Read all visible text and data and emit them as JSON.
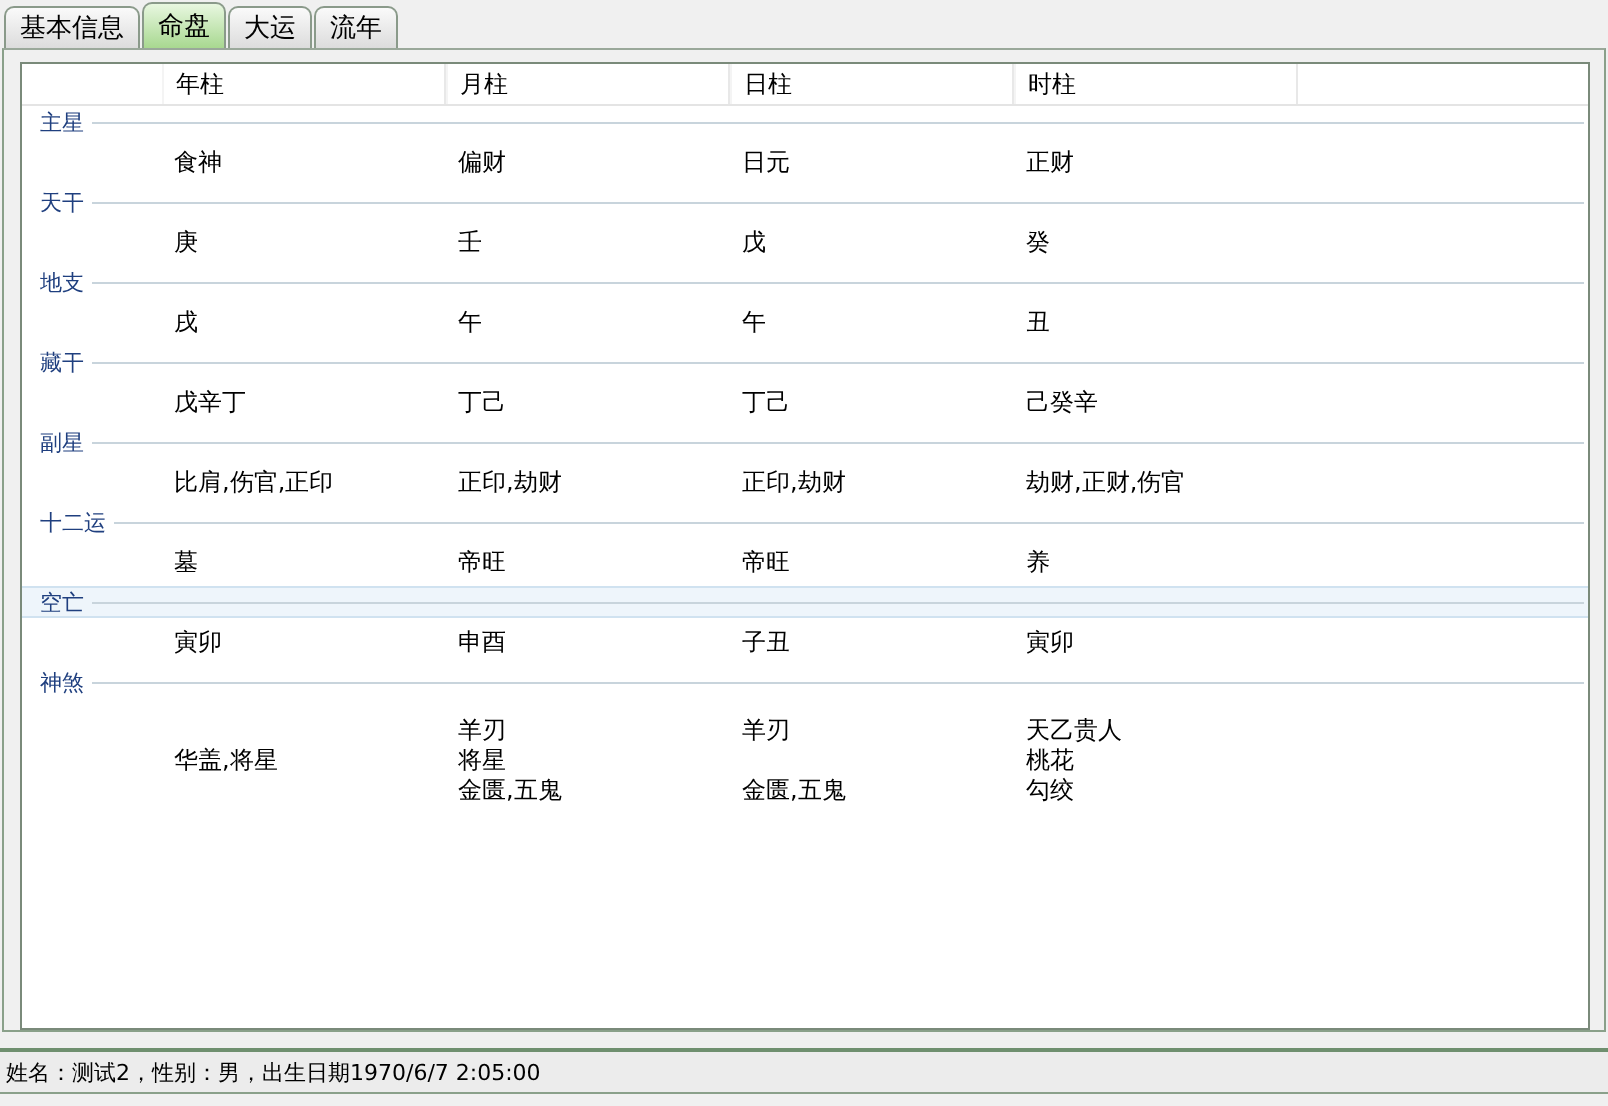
{
  "tabs": [
    {
      "label": "基本信息",
      "selected": false
    },
    {
      "label": "命盘",
      "selected": true
    },
    {
      "label": "大运",
      "selected": false
    },
    {
      "label": "流年",
      "selected": false
    }
  ],
  "table": {
    "columns": [
      "年柱",
      "月柱",
      "日柱",
      "时柱"
    ],
    "groups": [
      {
        "label": "主星",
        "selected": false,
        "cells": [
          [
            "食神"
          ],
          [
            "偏财"
          ],
          [
            "日元"
          ],
          [
            "正财"
          ]
        ]
      },
      {
        "label": "天干",
        "selected": false,
        "cells": [
          [
            "庚"
          ],
          [
            "壬"
          ],
          [
            "戊"
          ],
          [
            "癸"
          ]
        ]
      },
      {
        "label": "地支",
        "selected": false,
        "cells": [
          [
            "戌"
          ],
          [
            "午"
          ],
          [
            "午"
          ],
          [
            "丑"
          ]
        ]
      },
      {
        "label": "藏干",
        "selected": false,
        "cells": [
          [
            "戊辛丁"
          ],
          [
            "丁己"
          ],
          [
            "丁己"
          ],
          [
            "己癸辛"
          ]
        ]
      },
      {
        "label": "副星",
        "selected": false,
        "cells": [
          [
            "比肩,伤官,正印"
          ],
          [
            "正印,劫财"
          ],
          [
            "正印,劫财"
          ],
          [
            "劫财,正财,伤官"
          ]
        ]
      },
      {
        "label": "十二运",
        "selected": false,
        "cells": [
          [
            "墓"
          ],
          [
            "帝旺"
          ],
          [
            "帝旺"
          ],
          [
            "养"
          ]
        ]
      },
      {
        "label": "空亡",
        "selected": true,
        "cells": [
          [
            "寅卯"
          ],
          [
            "申酉"
          ],
          [
            "子丑"
          ],
          [
            "寅卯"
          ]
        ]
      },
      {
        "label": "神煞",
        "selected": false,
        "cells": [
          [
            "华盖,将星"
          ],
          [
            "羊刃",
            "将星",
            "金匮,五鬼"
          ],
          [
            "羊刃",
            null,
            "金匮,五鬼"
          ],
          [
            "天乙贵人",
            "桃花",
            "勾绞"
          ]
        ]
      }
    ]
  },
  "status_bar": "姓名：测试2，性别：男，出生日期1970/6/7 2:05:00"
}
